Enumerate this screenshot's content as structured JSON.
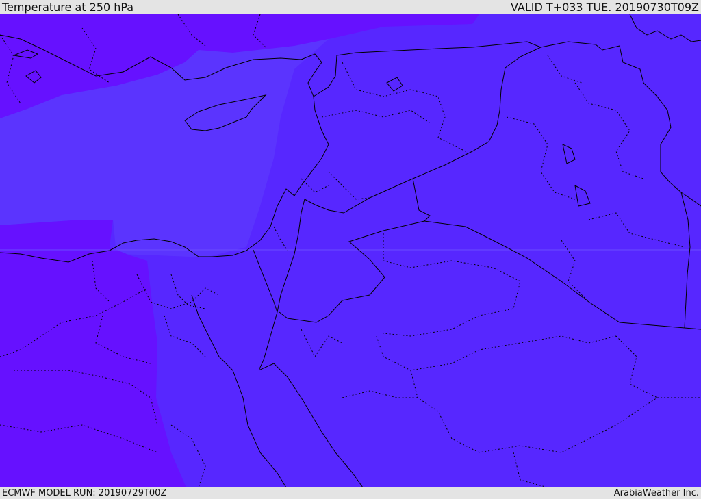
{
  "header": {
    "title": "Temperature at 250 hPa",
    "valid_time": "VALID T+033 TUE. 20190730T09Z"
  },
  "footer": {
    "model_run": "ECMWF MODEL RUN: 20190729T00Z",
    "credit": "ArabiaWeather Inc."
  },
  "colors": {
    "field_base": "#5727ff",
    "field_warm_band": "#6611ff",
    "sea_band": "#5b34fe",
    "borders": "#000000"
  }
}
